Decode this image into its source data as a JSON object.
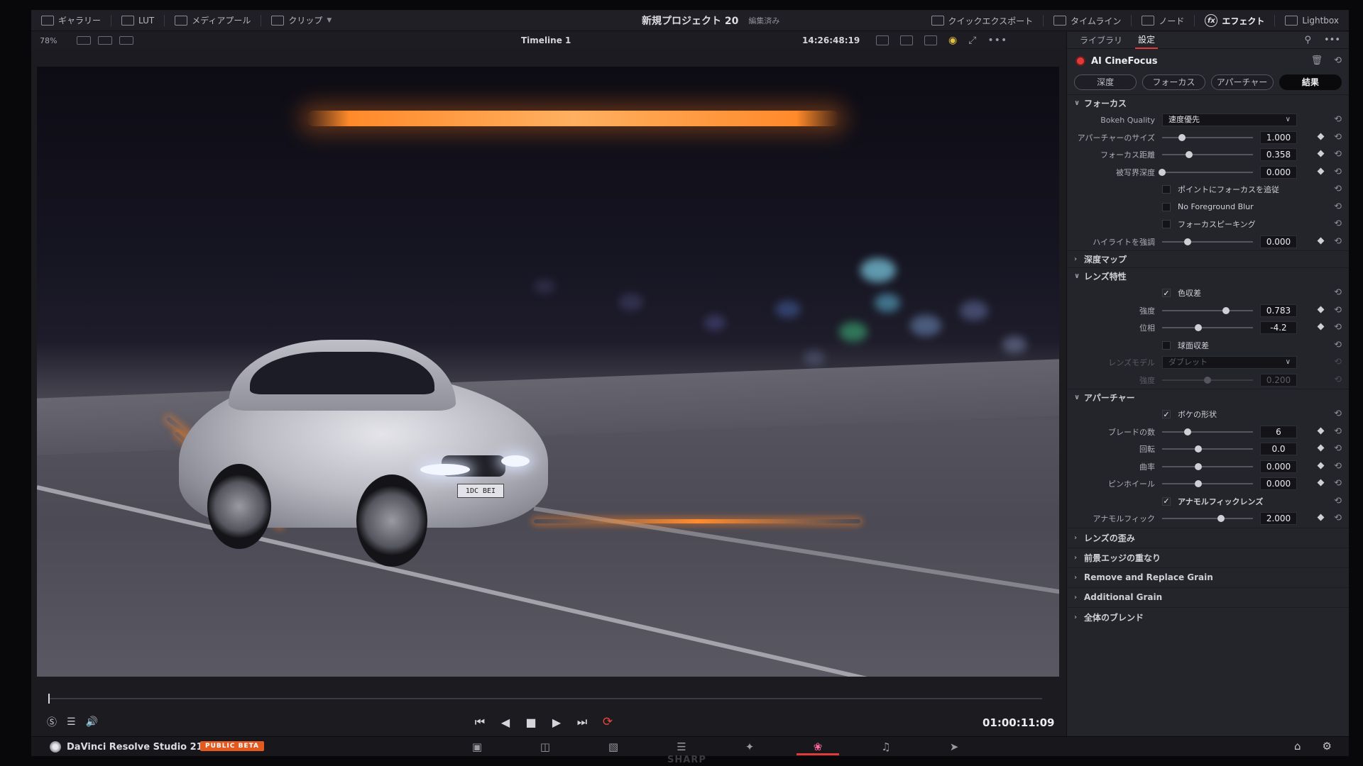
{
  "topbar": {
    "left": [
      {
        "label": "ギャラリー",
        "icon": "gallery-icon"
      },
      {
        "label": "LUT",
        "icon": "lut-icon"
      },
      {
        "label": "メディアプール",
        "icon": "media-pool-icon"
      },
      {
        "label": "クリップ",
        "icon": "clips-icon"
      }
    ],
    "project_title": "新規プロジェクト 20",
    "project_status": "編集済み",
    "right": [
      {
        "label": "クイックエクスポート",
        "icon": "export-icon"
      },
      {
        "label": "タイムライン",
        "icon": "timeline-icon"
      },
      {
        "label": "ノード",
        "icon": "nodes-icon"
      },
      {
        "label": "エフェクト",
        "icon": "fx-icon"
      },
      {
        "label": "Lightbox",
        "icon": "lightbox-icon"
      }
    ]
  },
  "viewer": {
    "zoom": "78%",
    "timeline_name": "Timeline 1",
    "timecode": "14:26:48:19",
    "plate_text": "1DC BEI"
  },
  "transport": {
    "timecode": "01:00:11:09"
  },
  "bottombar": {
    "app_name": "DaVinci Resolve Studio 21",
    "badge": "PUBLIC BETA",
    "active_page": "color"
  },
  "panel": {
    "tabs": [
      "ライブラリ",
      "設定"
    ],
    "effect_name": "AI CineFocus",
    "segments": [
      "深度",
      "フォーカス",
      "アパーチャー",
      "結果"
    ],
    "focus": {
      "title": "フォーカス",
      "bokeh_quality_label": "Bokeh Quality",
      "bokeh_quality_value": "速度優先",
      "aperture_size": {
        "label": "アパーチャーのサイズ",
        "value": "1.000",
        "level": 0.22
      },
      "focus_distance": {
        "label": "フォーカス距離",
        "value": "0.358",
        "level": 0.3
      },
      "dof": {
        "label": "被写界深度",
        "value": "0.000",
        "level": 0.0
      },
      "cb_follow": "ポイントにフォーカスを追従",
      "cb_no_fg_blur": "No Foreground Blur",
      "cb_peaking": "フォーカスピーキング",
      "highlight": {
        "label": "ハイライトを強調",
        "value": "0.000",
        "level": 0.28
      }
    },
    "depth_map": "深度マップ",
    "lens": {
      "title": "レンズ特性",
      "cb_chromatic": "色収差",
      "strength": {
        "label": "強度",
        "value": "0.783",
        "level": 0.7
      },
      "phase": {
        "label": "位相",
        "value": "-4.2",
        "level": 0.4
      },
      "cb_spherical": "球面収差",
      "lens_model_label": "レンズモデル",
      "lens_model_value": "ダブレット",
      "spherical_strength": {
        "label": "強度",
        "value": "0.200",
        "level": 0.5
      }
    },
    "aperture": {
      "title": "アパーチャー",
      "cb_bokeh_shape": "ボケの形状",
      "blades": {
        "label": "ブレードの数",
        "value": "6",
        "level": 0.28
      },
      "rotation": {
        "label": "回転",
        "value": "0.0",
        "level": 0.4
      },
      "curvature": {
        "label": "曲率",
        "value": "0.000",
        "level": 0.4
      },
      "pinwheel": {
        "label": "ピンホイール",
        "value": "0.000",
        "level": 0.4
      },
      "cb_anamorphic": "アナモルフィックレンズ",
      "anamorphic": {
        "label": "アナモルフィック",
        "value": "2.000",
        "level": 0.65
      }
    },
    "collapsed": [
      "レンズの歪み",
      "前景エッジの重なり",
      "Remove and Replace Grain",
      "Additional Grain",
      "全体のブレンド"
    ]
  }
}
